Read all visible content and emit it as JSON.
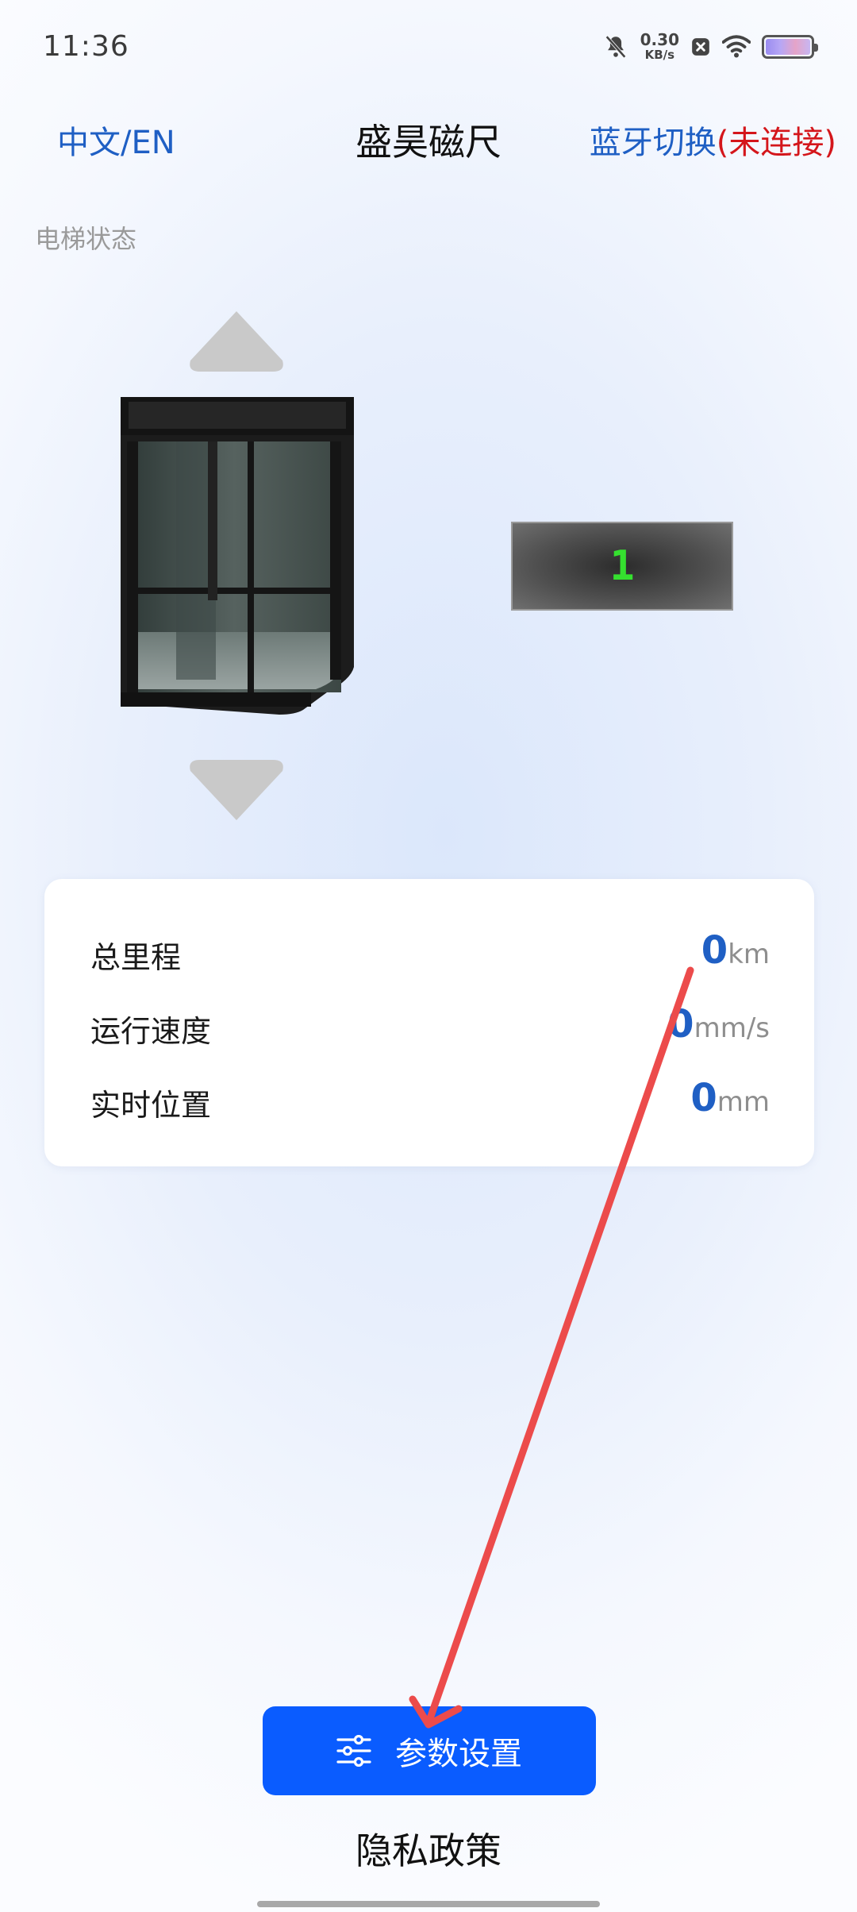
{
  "status_bar": {
    "time": "11:36",
    "net_speed_value": "0.30",
    "net_speed_unit": "KB/s",
    "icons": [
      "bell-muted-icon",
      "close-box-icon",
      "wifi-icon",
      "battery-icon"
    ]
  },
  "header": {
    "language_toggle": "中文/EN",
    "title": "盛昊磁尺",
    "bluetooth_label": "蓝牙切换",
    "bluetooth_status": "(未连接)"
  },
  "elevator": {
    "section_label": "电梯状态",
    "floor": "1",
    "icons": [
      "arrow-up-icon",
      "elevator-car-icon",
      "arrow-down-icon"
    ]
  },
  "stats": {
    "rows": [
      {
        "label": "总里程",
        "value": "0",
        "unit": "km"
      },
      {
        "label": "运行速度",
        "value": "0",
        "unit": "mm/s"
      },
      {
        "label": "实时位置",
        "value": "0",
        "unit": "mm"
      }
    ]
  },
  "actions": {
    "params_button": "参数设置",
    "params_icon": "sliders-icon",
    "privacy_link": "隐私政策"
  },
  "colors": {
    "primary_blue": "#0a5cff",
    "text_blue": "#1f5fc4",
    "status_red": "#d4161b",
    "floor_digit_green": "#35e02f",
    "annotation_red": "#ec4b4b"
  }
}
